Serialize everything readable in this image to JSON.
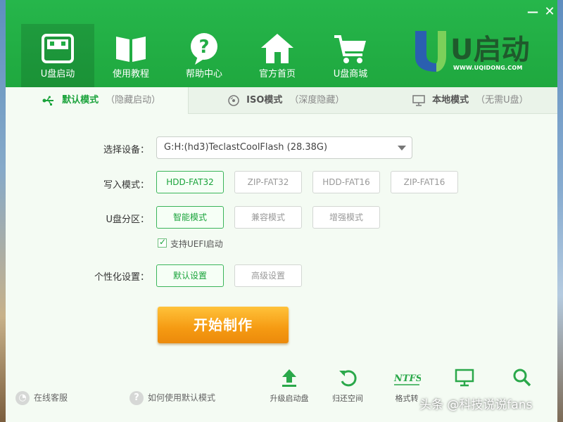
{
  "window": {
    "minimize_symbol": "—",
    "close_symbol": "✕"
  },
  "nav": [
    {
      "label": "U盘启动",
      "icon": "usb-drive-icon",
      "active": true
    },
    {
      "label": "使用教程",
      "icon": "book-icon",
      "active": false
    },
    {
      "label": "帮助中心",
      "icon": "help-bubble-icon",
      "active": false
    },
    {
      "label": "官方首页",
      "icon": "home-icon",
      "active": false
    },
    {
      "label": "U盘商城",
      "icon": "shopping-cart-icon",
      "active": false
    }
  ],
  "logo": {
    "text": "U启动",
    "url": "WWW.UQIDONG.COM"
  },
  "tabs": [
    {
      "title": "默认模式",
      "sub": "（隐藏启动）",
      "icon": "usb-symbol-icon",
      "active": true
    },
    {
      "title": "ISO模式",
      "sub": "（深度隐藏）",
      "icon": "disc-icon",
      "active": false
    },
    {
      "title": "本地模式",
      "sub": "（无需U盘）",
      "icon": "monitor-icon",
      "active": false
    }
  ],
  "form": {
    "device_label": "选择设备：",
    "device_value": "G:H:(hd3)TeclastCoolFlash (28.38G)",
    "write_label": "写入模式：",
    "write_options": [
      "HDD-FAT32",
      "ZIP-FAT32",
      "HDD-FAT16",
      "ZIP-FAT16"
    ],
    "write_selected": 0,
    "partition_label": "U盘分区：",
    "partition_options": [
      "智能模式",
      "兼容模式",
      "增强模式"
    ],
    "partition_selected": 0,
    "uefi_label": "支持UEFI启动",
    "uefi_checked": true,
    "personal_label": "个性化设置：",
    "personal_options": [
      "默认设置",
      "高级设置"
    ],
    "personal_selected": 0
  },
  "start_button": "开始制作",
  "footer": {
    "online_service": "在线客服",
    "how_to_use": "如何使用默认模式",
    "tools": [
      {
        "label": "升级启动盘",
        "icon": "upload-arrow-icon"
      },
      {
        "label": "归还空间",
        "icon": "restore-icon"
      },
      {
        "label": "格式转",
        "icon": "ntfs-icon"
      },
      {
        "label": "",
        "icon": "monitor-icon"
      },
      {
        "label": "",
        "icon": "search-icon"
      }
    ]
  },
  "watermark": "头条 @科技说说fans",
  "colors": {
    "header_green": "#1fa83f",
    "accent_green": "#1aa33b",
    "start_orange": "#f59a12"
  }
}
